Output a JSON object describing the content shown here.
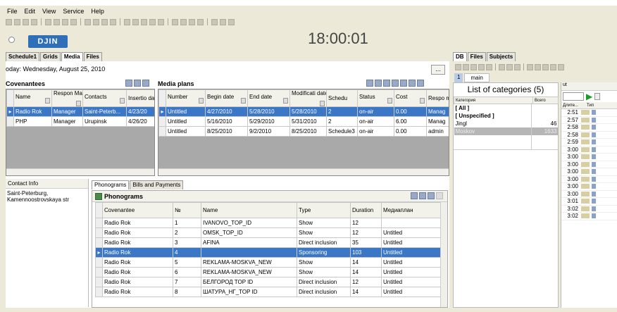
{
  "menu": [
    "File",
    "Edit",
    "View",
    "Service",
    "Help"
  ],
  "clock": "18:00:01",
  "logo": "DJIN",
  "left_tabs": [
    "Schedule1",
    "Grids",
    "Media",
    "Files"
  ],
  "today": "oday: Wednesday, August 25, 2010",
  "today_btn": "...",
  "covenantees": {
    "title": "Covenantees",
    "headers": [
      "Name",
      "Respon Manage",
      "Contacts",
      "Insertio date"
    ],
    "rows": [
      [
        "Radio Rok",
        "Manager",
        "Saint-Peterb...",
        "4/23/20"
      ],
      [
        "PHP",
        "Manager",
        "Urupinsk",
        "4/26/20"
      ]
    ]
  },
  "media_plans": {
    "title": "Media plans",
    "headers": [
      "Number",
      "Begin date",
      "End date",
      "Modificati date",
      "Schedu",
      "Status",
      "Cost",
      "Respo manag"
    ],
    "rows": [
      [
        "Untitled",
        "4/27/2010",
        "5/28/2010",
        "5/28/2010",
        "2",
        "on-air",
        "0.00",
        "Manag"
      ],
      [
        "Untitled",
        "5/16/2010",
        "5/29/2010",
        "5/31/2010",
        "2",
        "on-air",
        "6.00",
        "Manag"
      ],
      [
        "Untitled",
        "8/25/2010",
        "9/2/2010",
        "8/25/2010",
        "Schedule3",
        "on-air",
        "0.00",
        "admin"
      ]
    ]
  },
  "contact_info": {
    "label": "Contact Info",
    "text1": "Saint-Peterburg,",
    "text2": "Kamennoostrovskaya str"
  },
  "bottom_tabs": [
    "Phonograms",
    "Bills and Payments"
  ],
  "phonograms": {
    "title": "Phonograms",
    "headers": [
      "Covenantee",
      "№",
      "Name",
      "Type",
      "Duration",
      "Медиаплан"
    ],
    "rows": [
      [
        "Radio Rok",
        "1",
        "IVANOVO_TOP_ID",
        "Show",
        "12",
        ""
      ],
      [
        "Radio Rok",
        "2",
        "OMSK_TOP_ID",
        "Show",
        "12",
        "Untitled"
      ],
      [
        "Radio Rok",
        "3",
        "AFINA",
        "Direct inclusion",
        "35",
        "Untitled"
      ],
      [
        "Radio Rok",
        "4",
        "",
        "Sponsoring",
        "103",
        "Untitled"
      ],
      [
        "Radio Rok",
        "5",
        "REKLAMA-MOSKVA_NEW",
        "Show",
        "14",
        "Untitled"
      ],
      [
        "Radio Rok",
        "6",
        "REKLAMA-MOSKVA_NEW",
        "Show",
        "14",
        "Untitled"
      ],
      [
        "Radio Rok",
        "7",
        "БЕЛГОРОД TOP ID",
        "Direct inclusion",
        "12",
        "Untitled"
      ],
      [
        "Radio Rok",
        "8",
        "ШАТУРА_НГ_TOP ID",
        "Direct inclusion",
        "14",
        "Untitled"
      ]
    ]
  },
  "right_tabs": [
    "DB",
    "Files",
    "Subjects"
  ],
  "right_subtab_num": "1",
  "right_subtab": "main",
  "categories": {
    "title": "List of categories (5)",
    "col1": "Категория",
    "col2": "Всего",
    "rows": [
      [
        "[ All ]",
        ""
      ],
      [
        "[ Unspecified ]",
        ""
      ],
      [
        "Jingl",
        "46"
      ],
      [
        "Moskov",
        "1633"
      ]
    ]
  },
  "far_right": {
    "header1": "Длите...",
    "header2": "Тип",
    "durations": [
      "2:51",
      "2:57",
      "2:58",
      "2:58",
      "2:59",
      "3:00",
      "3:00",
      "3:00",
      "3:00",
      "3:00",
      "3:00",
      "3:00",
      "3:01",
      "3:02",
      "3:02"
    ],
    "tab": "ut"
  },
  "colors": {
    "selection": "#3a77c6",
    "logo": "#2e6fb7"
  }
}
